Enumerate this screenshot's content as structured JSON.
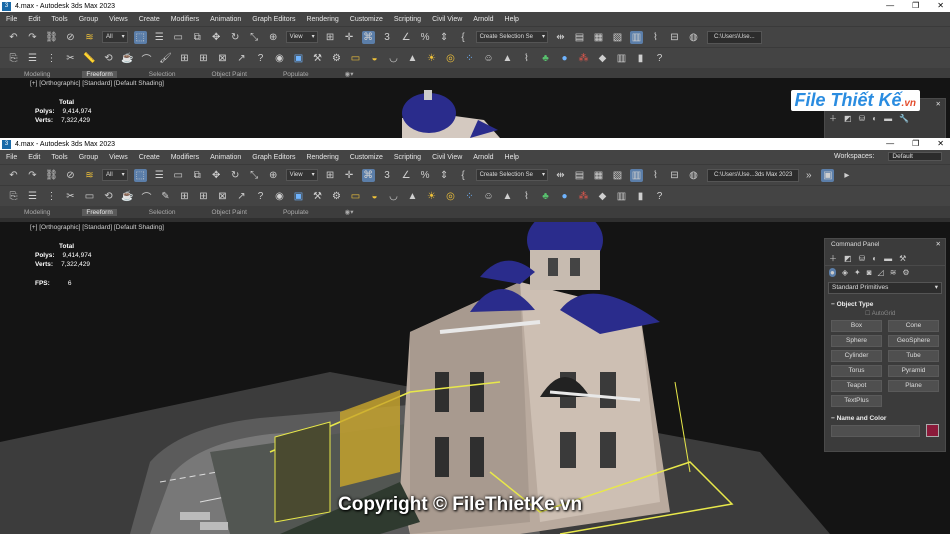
{
  "window1": {
    "title": "4.max - Autodesk 3ds Max 2023",
    "path": "C:\\Users\\Use...",
    "stats": {
      "total_label": "Total",
      "polys_label": "Polys:",
      "polys": "9,414,974",
      "verts_label": "Verts:",
      "verts": "7,322,429"
    }
  },
  "window2": {
    "title": "4.max - Autodesk 3ds Max 2023",
    "workspace_label": "Workspaces:",
    "workspace_value": "Default",
    "path": "C:\\Users\\Use...3ds Max 2023",
    "stats": {
      "total_label": "Total",
      "polys_label": "Polys:",
      "polys": "9,414,974",
      "verts_label": "Verts:",
      "verts": "7,322,429",
      "fps_label": "FPS:",
      "fps": "6"
    }
  },
  "menu": [
    "File",
    "Edit",
    "Tools",
    "Group",
    "Views",
    "Create",
    "Modifiers",
    "Animation",
    "Graph Editors",
    "Rendering",
    "Customize",
    "Scripting",
    "Civil View",
    "Arnold",
    "Help"
  ],
  "toolbar": {
    "filter": "All",
    "view": "View",
    "selection_set": "Create Selection Se"
  },
  "ribbon": [
    "Modeling",
    "Freeform",
    "Selection",
    "Object Paint",
    "Populate"
  ],
  "viewport_label": "[+] [Orthographic] [Standard] [Default Shading]",
  "command_panel": {
    "title": "Command Panel",
    "category": "Standard Primitives",
    "object_type_label": "Object Type",
    "autogrid": "AutoGrid",
    "buttons": [
      "Box",
      "Cone",
      "Sphere",
      "GeoSphere",
      "Cylinder",
      "Tube",
      "Torus",
      "Pyramid",
      "Teapot",
      "Plane",
      "TextPlus"
    ],
    "name_color_label": "Name and Color",
    "color": "#8b1a3a"
  },
  "watermark": "Copyright © FileThietKe.vn",
  "logo": {
    "main": "File Thiết Kế",
    "suffix": ".vn"
  },
  "colors": {
    "dome": "#2a2c8c",
    "wall": "#b9aa9e",
    "selection": "#e8e84a",
    "ui_bg": "#444444"
  }
}
